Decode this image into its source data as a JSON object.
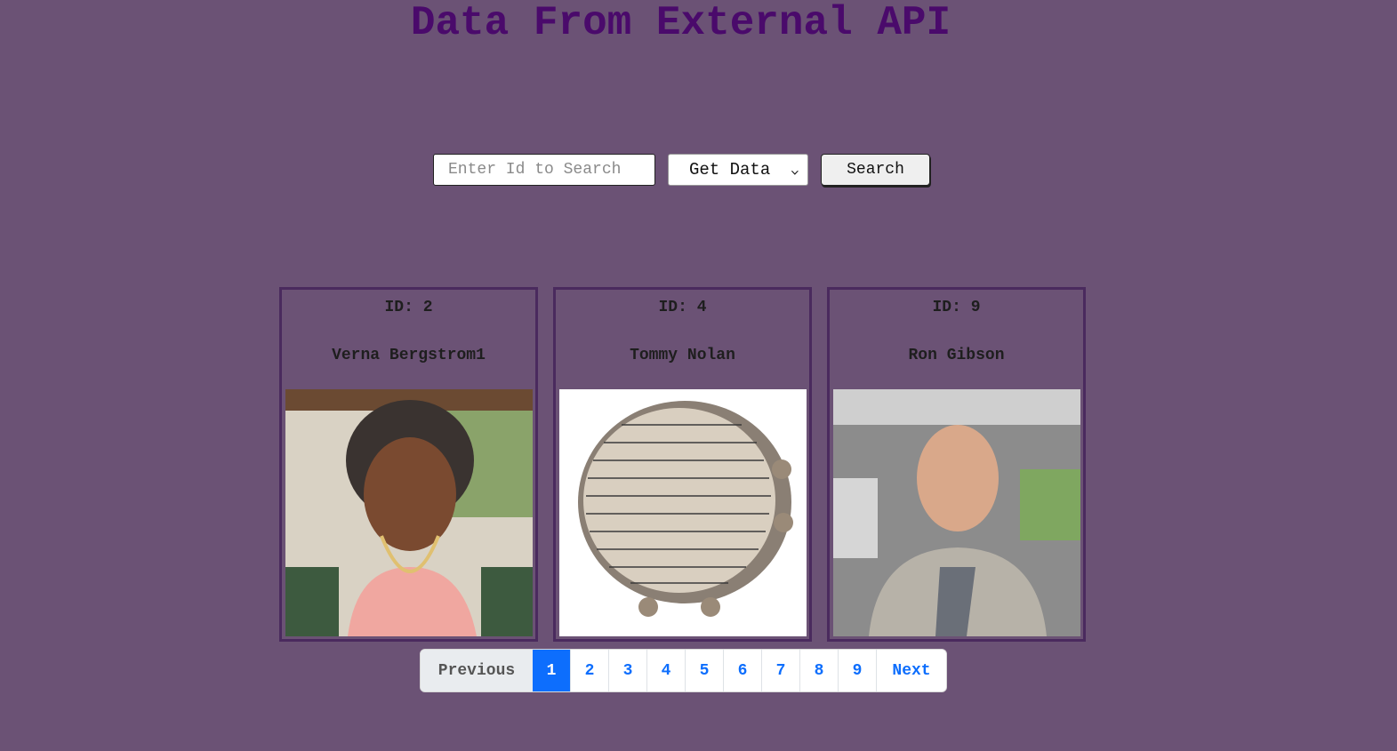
{
  "header": {
    "title": "Data From External API"
  },
  "search": {
    "placeholder": "Enter Id to Search",
    "select_value": "Get Data",
    "button_label": "Search"
  },
  "cards": [
    {
      "id_label": "ID: 2",
      "name": "Verna Bergstrom1",
      "photo": "elderly-woman-portrait"
    },
    {
      "id_label": "ID: 4",
      "name": "Tommy Nolan",
      "photo": "tambourine-with-text"
    },
    {
      "id_label": "ID: 9",
      "name": "Ron Gibson",
      "photo": "bald-man-car-selfie"
    }
  ],
  "pagination": {
    "previous_label": "Previous",
    "pages": [
      "1",
      "2",
      "3",
      "4",
      "5",
      "6",
      "7",
      "8",
      "9"
    ],
    "active_page": "1",
    "next_label": "Next"
  },
  "colors": {
    "background": "#6b5275",
    "title": "#4a0a6b",
    "card_border": "#4a2a5e",
    "page_active": "#0d6efd"
  }
}
